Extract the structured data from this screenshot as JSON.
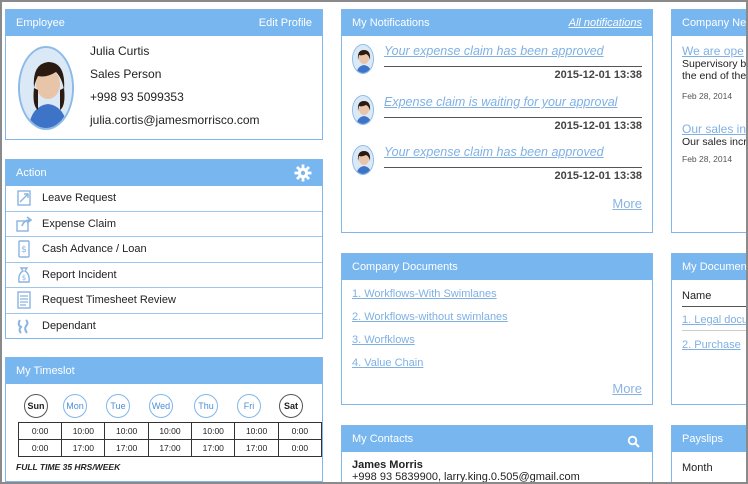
{
  "employee": {
    "header": "Employee",
    "edit_label": "Edit Profile",
    "name": "Julia Curtis",
    "role": "Sales Person",
    "phone": "+998 93 5099353",
    "email": "julia.cortis@jamesmorrisco.com"
  },
  "action": {
    "header": "Action",
    "settings_icon": "gear-icon",
    "items": [
      {
        "label": "Leave Request",
        "icon": "leave-icon"
      },
      {
        "label": "Expense Claim",
        "icon": "share-icon"
      },
      {
        "label": "Cash Advance / Loan",
        "icon": "money-icon"
      },
      {
        "label": "Report Incident",
        "icon": "money-bag-icon"
      },
      {
        "label": "Request Timesheet Review",
        "icon": "document-icon"
      },
      {
        "label": "Dependant",
        "icon": "dependant-icon"
      }
    ]
  },
  "timeslot": {
    "header": "My Timeslot",
    "days": [
      "Sun",
      "Mon",
      "Tue",
      "Wed",
      "Thu",
      "Fri",
      "Sat"
    ],
    "rows": [
      [
        "0:00",
        "10:00",
        "10:00",
        "10:00",
        "10:00",
        "10:00",
        "0:00"
      ],
      [
        "0:00",
        "17:00",
        "17:00",
        "17:00",
        "17:00",
        "17:00",
        "0:00"
      ]
    ],
    "footer": "FULL TIME 35 HRS/WEEK"
  },
  "notifications": {
    "header": "My Notifications",
    "all_label": "All notifications",
    "items": [
      {
        "text": "Your expense claim has been approved",
        "date": "2015-12-01 13:38"
      },
      {
        "text": "Expense claim is waiting for your approval",
        "date": "2015-12-01 13:38"
      },
      {
        "text": "Your expense claim has been approved",
        "date": "2015-12-01 13:38"
      }
    ],
    "more_label": "More"
  },
  "documents": {
    "header": "Company Documents",
    "items": [
      "1. Workflows-With Swimlanes",
      "2. Workflows-without swimlanes",
      "3. Worfklows",
      "4. Value Chain"
    ],
    "more_label": "More"
  },
  "contacts": {
    "header": "My Contacts",
    "search_icon": "search-icon",
    "name": "James Morris",
    "detail": "+998 93 5839900, larry.king.0.505@gmail.com"
  },
  "news": {
    "header": "Company New",
    "items": [
      {
        "title": "We are ope",
        "body1": "Supervisory bo",
        "body2": "the end of the",
        "date": "Feb 28, 2014"
      },
      {
        "title": "Our sales inc",
        "body1": "Our sales incr",
        "body2": "",
        "date": "Feb 28, 2014"
      }
    ]
  },
  "my_documents": {
    "header": "My Document",
    "column": "Name",
    "items": [
      "1. Legal docu",
      "2. Purchase"
    ]
  },
  "payslips": {
    "header": "Payslips",
    "column": "Month"
  },
  "colors": {
    "accent": "#78b6f0",
    "link": "#7fb0e4"
  }
}
